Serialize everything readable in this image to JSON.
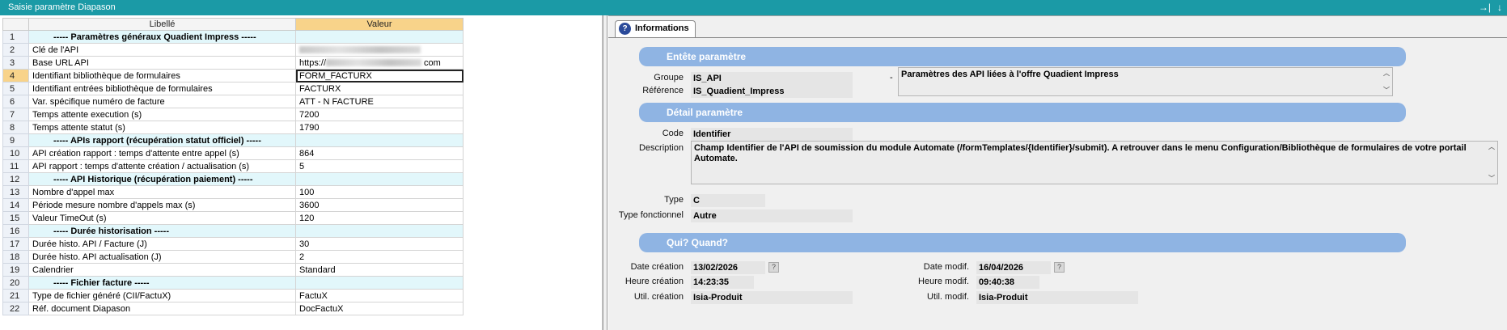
{
  "window": {
    "title": "Saisie paramètre Diapason",
    "controls": [
      "→|",
      "↓"
    ]
  },
  "grid": {
    "headers": {
      "label": "Libellé",
      "value": "Valeur"
    },
    "rows": [
      {
        "num": "1",
        "label": "----- Paramètres généraux Quadient Impress -----",
        "value": "",
        "section": true
      },
      {
        "num": "2",
        "label": "Clé de l'API",
        "value": "",
        "redacted": true
      },
      {
        "num": "3",
        "label": "Base URL API",
        "value": "https://",
        "suffix": "com",
        "redacted": true,
        "short": true
      },
      {
        "num": "4",
        "label": "Identifiant bibliothèque de formulaires",
        "value": "FORM_FACTURX",
        "selected": true
      },
      {
        "num": "5",
        "label": "Identifiant entrées bibliothèque de formulaires",
        "value": "FACTURX"
      },
      {
        "num": "6",
        "label": "Var. spécifique numéro de facture",
        "value": "ATT - N FACTURE"
      },
      {
        "num": "7",
        "label": "Temps attente execution (s)",
        "value": "7200"
      },
      {
        "num": "8",
        "label": "Temps attente statut (s)",
        "value": "1790"
      },
      {
        "num": "9",
        "label": "----- APIs rapport (récupération statut officiel) -----",
        "value": "",
        "section": true
      },
      {
        "num": "10",
        "label": "API création rapport : temps d'attente entre appel (s)",
        "value": "864"
      },
      {
        "num": "11",
        "label": "API rapport : temps d'attente création / actualisation (s)",
        "value": "5"
      },
      {
        "num": "12",
        "label": "----- API Historique (récupération paiement) -----",
        "value": "",
        "section": true
      },
      {
        "num": "13",
        "label": "Nombre d'appel max",
        "value": "100"
      },
      {
        "num": "14",
        "label": "Période mesure nombre d'appels max (s)",
        "value": "3600"
      },
      {
        "num": "15",
        "label": "Valeur TimeOut (s)",
        "value": "120"
      },
      {
        "num": "16",
        "label": "----- Durée historisation -----",
        "value": "",
        "section": true
      },
      {
        "num": "17",
        "label": "Durée histo. API / Facture (J)",
        "value": "30"
      },
      {
        "num": "18",
        "label": "Durée histo. API actualisation (J)",
        "value": "2"
      },
      {
        "num": "19",
        "label": "Calendrier",
        "value": "Standard"
      },
      {
        "num": "20",
        "label": "----- Fichier facture -----",
        "value": "",
        "section": true
      },
      {
        "num": "21",
        "label": "Type de fichier généré (CII/FactuX)",
        "value": "FactuX"
      },
      {
        "num": "22",
        "label": "Réf. document Diapason",
        "value": "DocFactuX"
      }
    ]
  },
  "info": {
    "tab_label": "Informations",
    "help_glyph": "?",
    "header_section": {
      "title": "Entête paramètre",
      "groupe_label": "Groupe",
      "groupe_value": "IS_API",
      "dash": "-",
      "groupe_desc": "Paramètres des API liées à l'offre Quadient Impress",
      "reference_label": "Référence",
      "reference_value": "IS_Quadient_Impress"
    },
    "detail_section": {
      "title": "Détail paramètre",
      "code_label": "Code",
      "code_value": "Identifier",
      "description_label": "Description",
      "description_value": "Champ Identifier de l'API de soumission du module Automate (/formTemplates/{Identifier}/submit). A retrouver dans le menu Configuration/Bibliothèque de formulaires de votre portail Automate.",
      "type_label": "Type",
      "type_value": "C",
      "type_fonc_label": "Type fonctionnel",
      "type_fonc_value": "Autre"
    },
    "who_section": {
      "title": "Qui? Quand?",
      "date_creation_label": "Date création",
      "date_creation_value": "13/02/2026",
      "heure_creation_label": "Heure création",
      "heure_creation_value": "14:23:35",
      "util_creation_label": "Util. création",
      "util_creation_value": "Isia-Produit",
      "date_modif_label": "Date modif.",
      "date_modif_value": "16/04/2026",
      "heure_modif_label": "Heure modif.",
      "heure_modif_value": "09:40:38",
      "util_modif_label": "Util. modif.",
      "util_modif_value": "Isia-Produit"
    }
  }
}
